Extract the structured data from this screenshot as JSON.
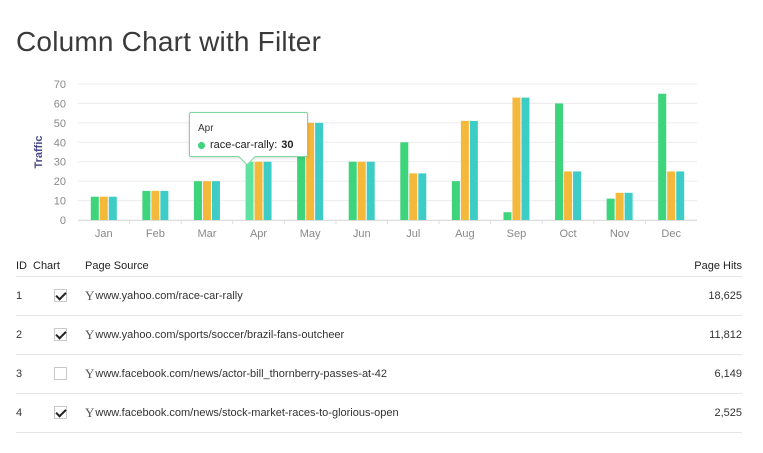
{
  "title": "Column Chart with Filter",
  "chart_data": {
    "type": "bar",
    "ylabel": "Traffic",
    "ylim": [
      0,
      70
    ],
    "yticks": [
      "0",
      "10",
      "20",
      "30",
      "40",
      "50",
      "60",
      "70"
    ],
    "grid": true,
    "categories": [
      "Jan",
      "Feb",
      "Mar",
      "Apr",
      "May",
      "Jun",
      "Jul",
      "Aug",
      "Sep",
      "Oct",
      "Nov",
      "Dec"
    ],
    "series": [
      {
        "name": "race-car-rally",
        "color": "#3dd47c",
        "values": [
          12,
          15,
          20,
          30,
          50,
          30,
          40,
          20,
          4,
          60,
          11,
          65
        ]
      },
      {
        "color": "#f4b93b",
        "values": [
          12,
          15,
          20,
          30,
          50,
          30,
          24,
          51,
          63,
          25,
          14,
          25
        ]
      },
      {
        "color": "#3ecdc6",
        "values": [
          12,
          15,
          20,
          30,
          50,
          30,
          24,
          51,
          63,
          25,
          14,
          25
        ]
      }
    ],
    "highlight": {
      "series": 0,
      "category": 3,
      "color": "#5fe3a0"
    }
  },
  "tooltip": {
    "category": "Apr",
    "series": "race-car-rally",
    "value": "30",
    "color": "#3dd47c"
  },
  "table": {
    "headers": {
      "id": "ID",
      "chart": "Chart",
      "source": "Page Source",
      "hits": "Page Hits"
    },
    "rows": [
      {
        "id": "1",
        "checked": true,
        "icon": "Y",
        "source": "www.yahoo.com/race-car-rally",
        "hits": "18,625"
      },
      {
        "id": "2",
        "checked": true,
        "icon": "Y",
        "source": "www.yahoo.com/sports/soccer/brazil-fans-outcheer",
        "hits": "11,812"
      },
      {
        "id": "3",
        "checked": false,
        "icon": "Y",
        "source": "www.facebook.com/news/actor-bill_thornberry-passes-at-42",
        "hits": "6,149"
      },
      {
        "id": "4",
        "checked": true,
        "icon": "Y",
        "source": "www.facebook.com/news/stock-market-races-to-glorious-open",
        "hits": "2,525"
      }
    ]
  }
}
